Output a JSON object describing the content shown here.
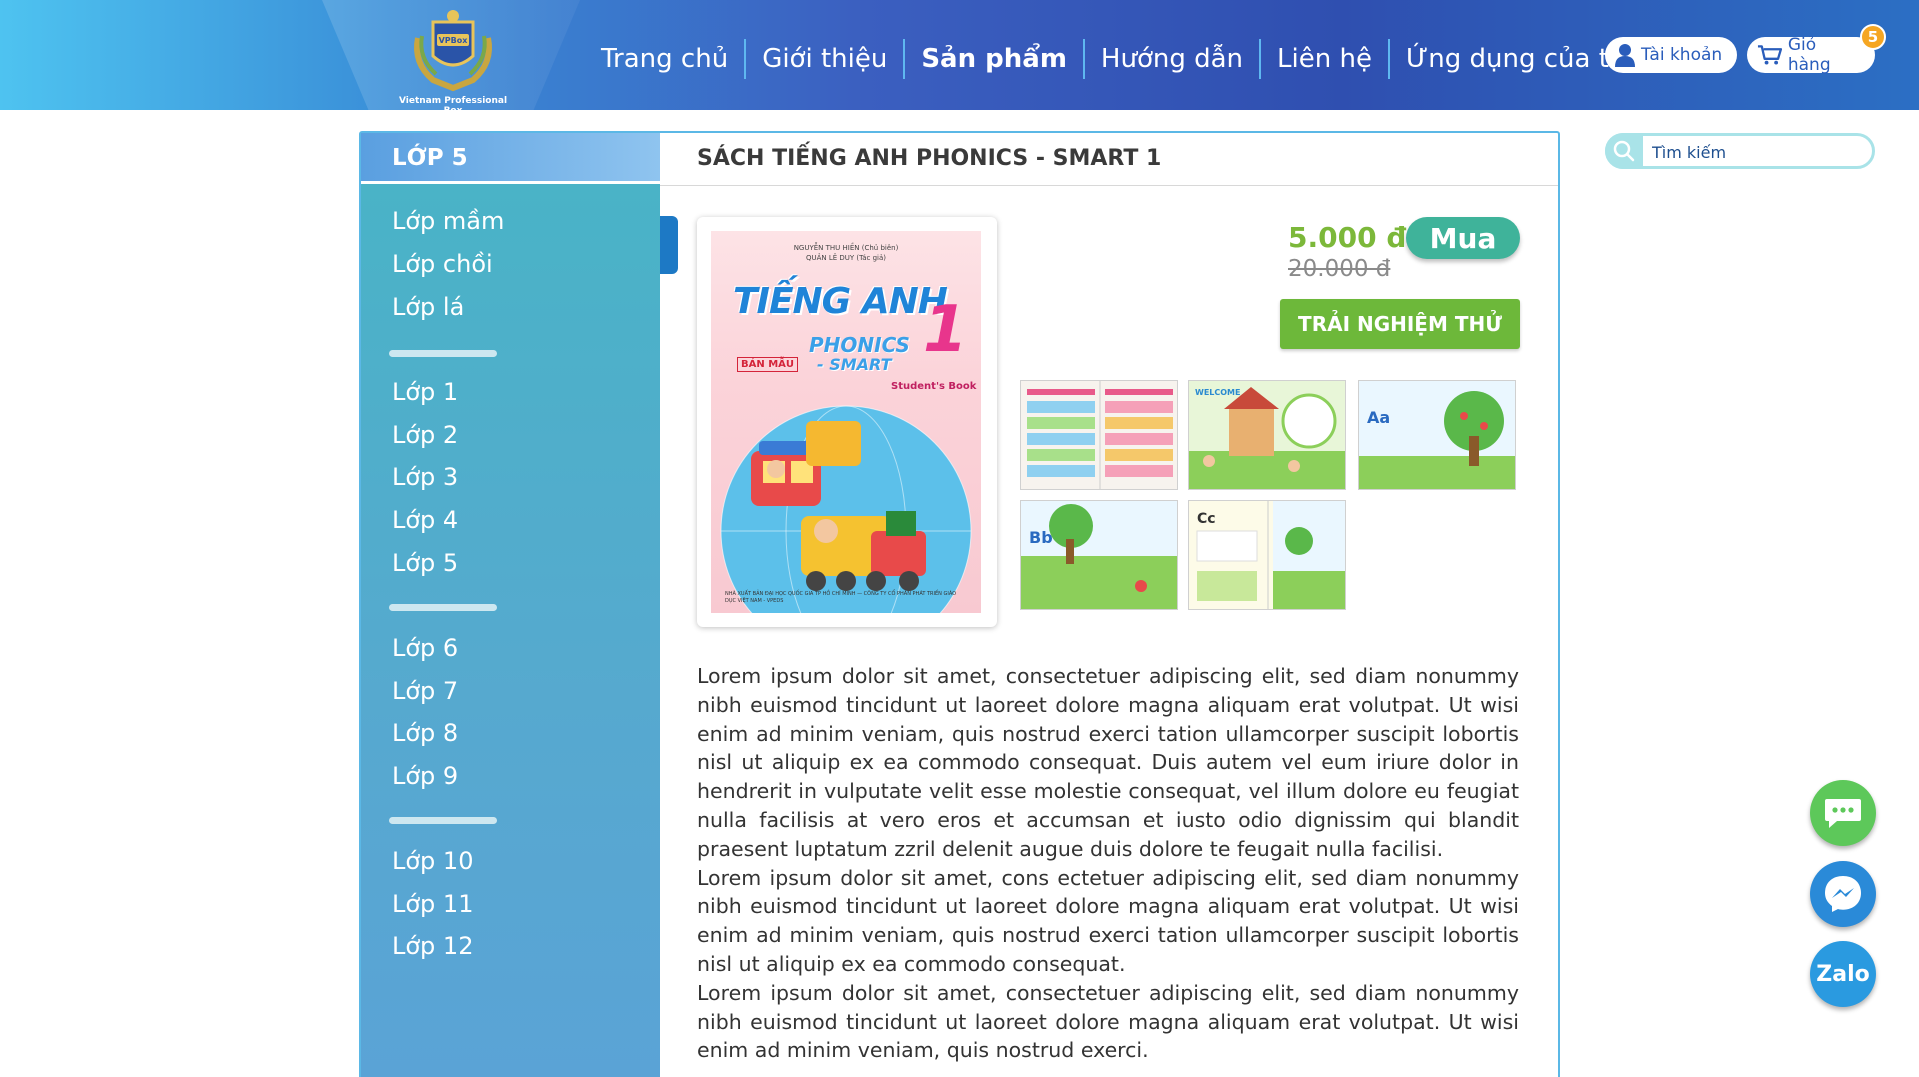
{
  "header": {
    "logo_text": "Vietnam Professional Box",
    "logo_badge": "VPBox",
    "nav": [
      "Trang chủ",
      "Giới thiệu",
      "Sản phẩm",
      "Hướng dẫn",
      "Liên hệ",
      "Ứng dụng của tôi"
    ],
    "active_nav": "Sản phẩm",
    "account_label": "Tài khoản",
    "cart_label": "Giỏ hàng",
    "cart_count": "5"
  },
  "search": {
    "placeholder": "Tìm kiếm"
  },
  "sidebar": {
    "title": "LỚP 5",
    "groups": [
      [
        "Lớp mầm",
        "Lớp chồi",
        "Lớp lá"
      ],
      [
        "Lớp 1",
        "Lớp 2",
        "Lớp 3",
        "Lớp 4",
        "Lớp 5"
      ],
      [
        "Lớp 6",
        "Lớp 7",
        "Lớp 8",
        "Lớp 9"
      ],
      [
        "Lớp 10",
        "Lớp 11",
        "Lớp 12"
      ]
    ]
  },
  "product": {
    "title": "SÁCH TIẾNG ANH PHONICS - SMART 1",
    "price_new": "5.000 đ",
    "price_old": "20.000 đ",
    "buy_label": "Mua",
    "try_label": "TRẢI NGHIỆM THỬ",
    "cover": {
      "authors": "NGUYỄN THU HIỀN (Chủ biên)\nQUẢN LÊ DUY (Tác giả)",
      "title_main": "TIẾNG ANH",
      "title_sub1": "PHONICS",
      "title_sub2": "- SMART",
      "number": "1",
      "sample": "BẢN MẪU",
      "book_type": "Student's Book",
      "publisher": "NHÀ XUẤT BẢN ĐẠI HỌC QUỐC GIA TP HỒ CHÍ MINH — CÔNG TY CỔ PHẦN PHÁT TRIỂN GIÁO DỤC VIỆT NAM - VPEDS"
    },
    "thumb_labels": [
      "WELCOME",
      "Aa",
      "Bb",
      "Cc"
    ],
    "description": [
      "Lorem ipsum dolor sit amet, consectetuer adipiscing elit, sed diam nonummy nibh euismod tincidunt ut laoreet dolore magna aliquam erat volutpat. Ut wisi enim ad minim veniam, quis nostrud exerci tation ullamcorper suscipit lobortis nisl ut aliquip ex ea commodo consequat. Duis autem vel eum iriure dolor in hendrerit in vulputate velit esse molestie consequat, vel illum dolore eu feugiat nulla facilisis at vero eros et accumsan et iusto odio dignissim qui blandit praesent luptatum zzril delenit augue duis dolore te feugait nulla facilisi.",
      "Lorem ipsum dolor sit amet, cons ectetuer adipiscing elit, sed diam nonummy nibh euismod tincidunt ut laoreet dolore magna aliquam erat volutpat. Ut wisi enim ad minim veniam, quis nostrud exerci tation ullamcorper suscipit lobortis nisl ut aliquip ex ea commodo consequat.",
      "Lorem ipsum dolor sit amet, consectetuer adipiscing elit, sed diam nonummy nibh euismod tincidunt ut laoreet dolore magna aliquam erat volutpat. Ut wisi enim ad minim veniam, quis nostrud exerci."
    ]
  },
  "floating": {
    "zalo_label": "Zalo"
  },
  "colors": {
    "accent_green": "#7cb83a",
    "buy_teal": "#3fb39a",
    "header_blue": "#2f4fb0",
    "sidebar_teal": "#48b4c6"
  },
  "icons": [
    "user-icon",
    "cart-icon",
    "search-icon",
    "chat-icon",
    "messenger-icon",
    "zalo-icon"
  ]
}
